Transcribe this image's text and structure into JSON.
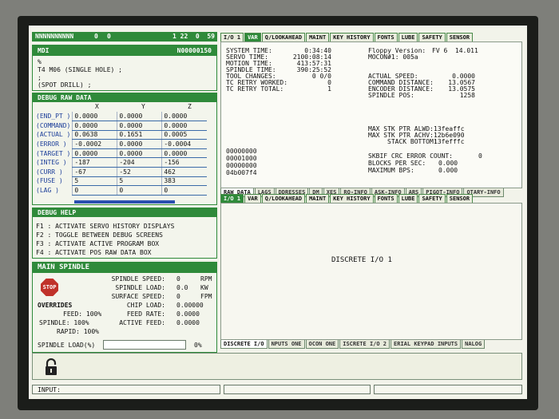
{
  "status_bar": {
    "left": "NNNNNNNNNN",
    "c1": "0",
    "c2": "0",
    "right": "1 22  0  59"
  },
  "top_tabs": [
    "I/O 1",
    "VAR",
    "Q/LOOKAHEAD",
    "MAINT",
    "KEY HISTORY",
    "FONTS",
    "LUBE",
    "SAFETY",
    "SENSOR"
  ],
  "mdi": {
    "title": "MDI",
    "program": "N00000150",
    "lines": [
      "%",
      "T4 M06 (SINGLE HOLE) ;",
      ";",
      "(SPOT DRILL) ;"
    ]
  },
  "debug_raw": {
    "title": "DEBUG RAW DATA",
    "headers": [
      "X",
      "Y",
      "Z"
    ],
    "rows": [
      {
        "label": "(END_PT )",
        "x": "0.0000",
        "y": "0.0000",
        "z": "0.0000"
      },
      {
        "label": "(COMMAND)",
        "x": "0.0000",
        "y": "0.0000",
        "z": "0.0000"
      },
      {
        "label": "(ACTUAL )",
        "x": "0.0638",
        "y": "0.1651",
        "z": "0.0005"
      },
      {
        "label": "(ERROR  )",
        "x": "-0.0002",
        "y": "0.0000",
        "z": "-0.0004"
      },
      {
        "label": "(TARGET )",
        "x": "0.0000",
        "y": "0.0000",
        "z": "0.0000"
      },
      {
        "label": "(INTEG  )",
        "x": "-187",
        "y": "-204",
        "z": "-156"
      },
      {
        "label": "(CURR   )",
        "x": "-67",
        "y": "-52",
        "z": "462"
      },
      {
        "label": "(FUSE   )",
        "x": "5",
        "y": "5",
        "z": "383"
      },
      {
        "label": "(LAG    )",
        "x": "0",
        "y": "0",
        "z": "0"
      }
    ]
  },
  "debug_help": {
    "title": "DEBUG HELP",
    "lines": [
      "F1 : ACTIVATE SERVO HISTORY DISPLAYS",
      "F2 : TOGGLE BETWEEN DEBUG SCREENS",
      "F3 : ACTIVATE ACTIVE PROGRAM BOX",
      "F4 : ACTIVATE POS RAW DATA BOX"
    ]
  },
  "spindle": {
    "title": "MAIN SPINDLE",
    "stop": "STOP",
    "overrides_label": "OVERRIDES",
    "feed": "FEED: 100%",
    "spindle": "SPINDLE: 100%",
    "rapid": "RAPID: 100%",
    "stats": [
      {
        "label": "SPINDLE SPEED:",
        "value": "0",
        "unit": "RPM"
      },
      {
        "label": "SPINDLE LOAD:",
        "value": "0.0",
        "unit": "KW"
      },
      {
        "label": "SURFACE SPEED:",
        "value": "0",
        "unit": "FPM"
      },
      {
        "label": "CHIP LOAD:",
        "value": "0.00000",
        "unit": ""
      },
      {
        "label": "FEED RATE:",
        "value": "0.0000",
        "unit": ""
      },
      {
        "label": "ACTIVE FEED:",
        "value": "0.0000",
        "unit": ""
      }
    ],
    "load_label": "SPINDLE LOAD(%)",
    "load_value": "0%"
  },
  "var_panel": {
    "left": [
      {
        "label": "SYSTEM TIME:",
        "value": "0:34:40"
      },
      {
        "label": "SERVO TIME:",
        "value": "2100:08:14"
      },
      {
        "label": "MOTION TIME:",
        "value": "413:57:31"
      },
      {
        "label": "SPINDLE TIME:",
        "value": "390:25:52"
      },
      {
        "label": "TOOL CHANGES:",
        "value": "0 0/0"
      },
      {
        "label": "TC RETRY WORKED:",
        "value": "0"
      },
      {
        "label": "TC RETRY TOTAL:",
        "value": "1"
      }
    ],
    "floppy_label": "Floppy Version:",
    "floppy_value": "FV 6  14.011",
    "mocon": "MOCON#1: 005a",
    "right": [
      {
        "label": "ACTUAL SPEED:",
        "value": "0.0000"
      },
      {
        "label": "COMMAND DISTANCE:",
        "value": "13.0567"
      },
      {
        "label": "ENCODER DISTANCE:",
        "value": "13.0575"
      },
      {
        "label": "SPINDLE POS:",
        "value": "1258"
      }
    ],
    "stk": [
      {
        "label": "MAX STK PTR ALWD:",
        "value": "13feaffc"
      },
      {
        "label": "MAX STK PTR ACHV:",
        "value": "12b6e090"
      },
      {
        "label": "STACK BOTTOM:",
        "value": "13fefffc"
      }
    ],
    "hex": [
      "00000000",
      "00001000",
      "00000000",
      "04b007f4"
    ],
    "bottom": [
      {
        "label": "SKBIF CRC ERROR COUNT:",
        "value": "0"
      },
      {
        "label": "BLOCKS PER SEC:",
        "value": "0.000"
      },
      {
        "label": "MAXIMUM BPS:",
        "value": "0.000"
      }
    ]
  },
  "var_tabs": [
    "RAW DATA",
    "LAGS",
    "DDRESSES",
    "DM",
    "XES",
    "RQ-INFO",
    "ASK-INFO",
    "ARS",
    "PIGOT-INFO",
    "OTARY-INFO"
  ],
  "io_tabs": [
    "I/O 1",
    "VAR",
    "Q/LOOKAHEAD",
    "MAINT",
    "KEY HISTORY",
    "FONTS",
    "LUBE",
    "SAFETY",
    "SENSOR"
  ],
  "io_body": "DISCRETE I/O 1",
  "io_bottom_tabs": [
    "DISCRETE I/O",
    "NPUTS ONE",
    "OCON ONE",
    "ISCRETE I/O 2",
    "ERIAL KEYPAD INPUTS",
    "NALOG"
  ],
  "input_label": "INPUT:"
}
